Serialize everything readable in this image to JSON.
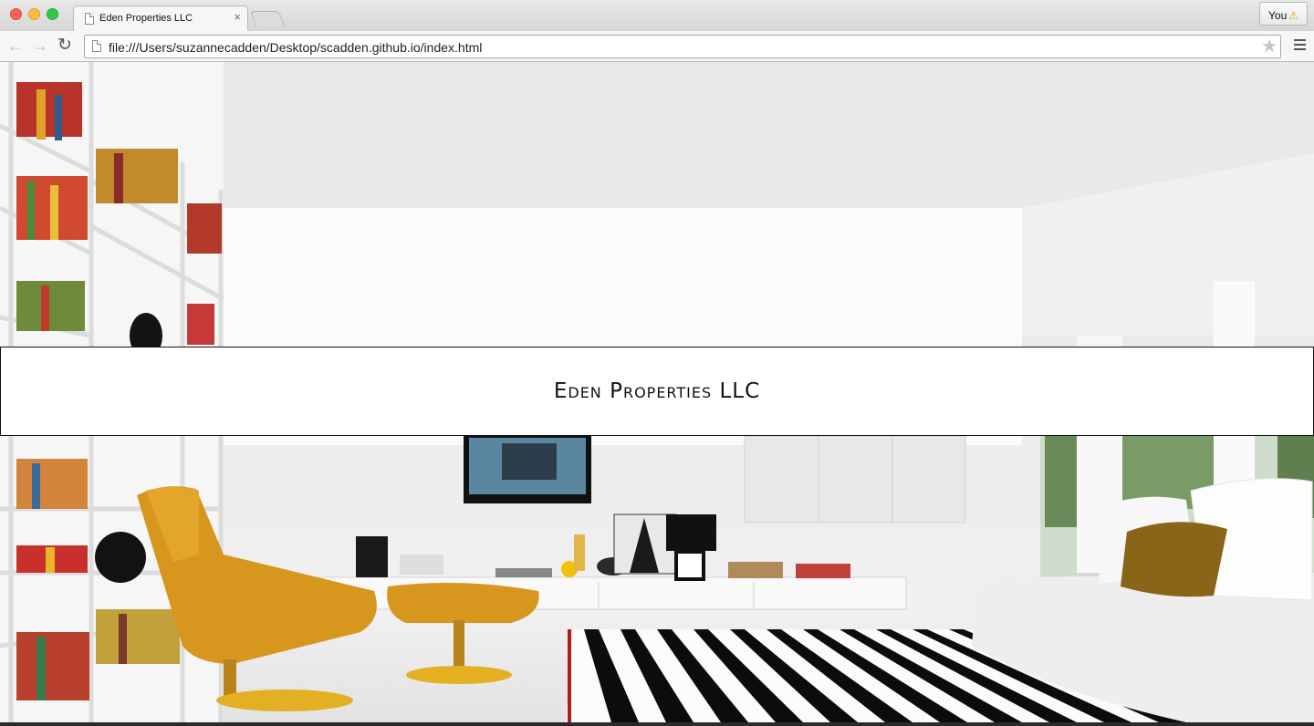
{
  "browser": {
    "tab_title": "Eden Properties LLC",
    "tab_close": "×",
    "profile_label": "You",
    "profile_warning_icon": "warning-icon",
    "url": "file:///Users/suzannecadden/Desktop/scadden.github.io/index.html",
    "icons": {
      "back": "arrow-left-icon",
      "forward": "arrow-right-icon",
      "reload": "reload-icon",
      "bookmark": "star-icon",
      "menu": "hamburger-menu-icon"
    }
  },
  "page": {
    "banner_title": "Eden Properties LLC",
    "background_image": "modern white living room photo"
  }
}
